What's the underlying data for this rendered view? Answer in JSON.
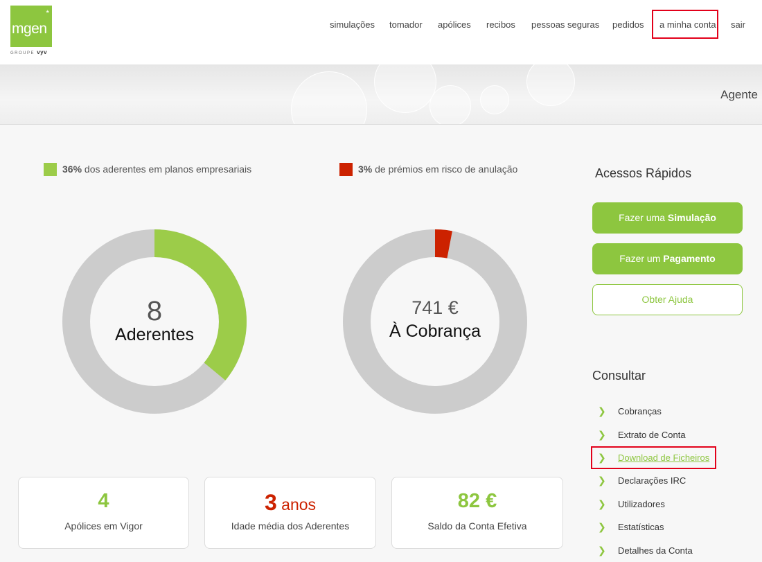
{
  "logo": {
    "brand": "mgen",
    "star": "*",
    "group_prefix": "GROUPE",
    "group_name": "vyv"
  },
  "nav": [
    {
      "label": "simulações",
      "active": false
    },
    {
      "label": "tomador",
      "active": false
    },
    {
      "label": "apólices",
      "active": false
    },
    {
      "label": "recibos",
      "active": false
    },
    {
      "label": "pessoas seguras",
      "active": false
    },
    {
      "label": "pedidos",
      "active": false
    },
    {
      "label": "a minha conta",
      "active": true
    },
    {
      "label": "sair",
      "active": false
    }
  ],
  "banner": {
    "label": "Agente"
  },
  "legends": [
    {
      "percent": "36%",
      "text": " dos aderentes em planos empresariais",
      "color": "#8dc63f"
    },
    {
      "percent": "3%",
      "text": " de prémios em risco de anulação",
      "color": "#cc2200"
    }
  ],
  "donuts": [
    {
      "number": "8",
      "label": "Aderentes",
      "fraction": 0.36,
      "color": "#9ccc49",
      "track": "#cccccc"
    },
    {
      "number": "741 €",
      "label": "À Cobrança",
      "fraction": 0.03,
      "color": "#cc2200",
      "track": "#cccccc"
    }
  ],
  "cards": [
    {
      "value": "4",
      "unit": "",
      "label": "Apólices em Vigor",
      "color": "#8dc63f"
    },
    {
      "value": "3",
      "unit": " anos",
      "label": "Idade média dos Aderentes",
      "color": "#cc2200"
    },
    {
      "value": "82 €",
      "unit": "",
      "label": "Saldo da Conta Efetiva",
      "color": "#8dc63f"
    }
  ],
  "quick_access": {
    "title": "Acessos Rápidos",
    "buttons": [
      {
        "prefix": "Fazer uma ",
        "bold": "Simulação",
        "style": "solid"
      },
      {
        "prefix": "Fazer um ",
        "bold": "Pagamento",
        "style": "solid"
      },
      {
        "prefix": "Obter Ajuda",
        "bold": "",
        "style": "outline"
      }
    ]
  },
  "consult": {
    "title": "Consultar",
    "links": [
      {
        "label": "Cobranças",
        "active": false
      },
      {
        "label": "Extrato de Conta",
        "active": false
      },
      {
        "label": "Download de Ficheiros",
        "active": true
      },
      {
        "label": "Declarações IRC",
        "active": false
      },
      {
        "label": "Utilizadores",
        "active": false
      },
      {
        "label": "Estatísticas",
        "active": false
      },
      {
        "label": "Detalhes da Conta",
        "active": false
      }
    ]
  },
  "colors": {
    "brand_green": "#8dc63f",
    "alert_red": "#cc2200",
    "highlight_red": "#e2001a"
  }
}
